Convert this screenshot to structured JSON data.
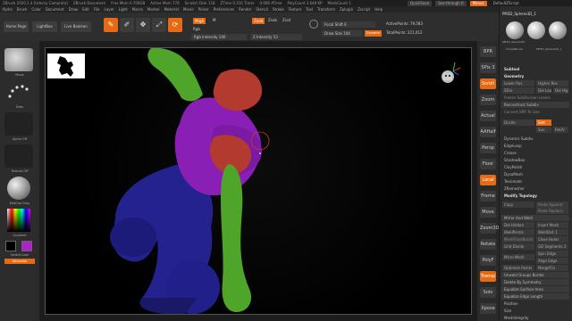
{
  "titlebar": {
    "title": "ZBrush 2020.1.4 [Udemy Camaroto]",
    "doc": "ZBrush Document",
    "stats": [
      "Free Mem 0.700GB",
      "Active Mem 776",
      "Scratch Disk 118",
      "ZTime 0.316 Timer",
      "0.006 ATime",
      "PolyCount 3.649 KP",
      "MeshCount 1"
    ]
  },
  "quicksave": {
    "quicksave_label": "QuickSave",
    "seethrough_label": "See-through 0",
    "menus_label": "Menus",
    "script_label": "DefaultZScript"
  },
  "menu": [
    "Alpha",
    "Brush",
    "Color",
    "Document",
    "Draw",
    "Edit",
    "File",
    "Layer",
    "Light",
    "Macro",
    "Marker",
    "Material",
    "Movie",
    "Picker",
    "Preferences",
    "Render",
    "Stencil",
    "Stroke",
    "Texture",
    "Tool",
    "Transform",
    "Zplugin",
    "Zscript",
    "Help"
  ],
  "toolbar": {
    "homepage": "Home Page",
    "lightbox": "LightBox",
    "liveboolean": "Live Boolean",
    "tools": [
      {
        "label": "Edit",
        "icon": "edit-icon"
      },
      {
        "label": "Draw",
        "icon": "draw-icon"
      },
      {
        "label": "Move",
        "icon": "move-icon"
      },
      {
        "label": "Scale",
        "icon": "scale-icon"
      },
      {
        "label": "Rotate",
        "icon": "rotate-icon"
      }
    ],
    "mrgb": "Mrgb",
    "rgb": "Rgb",
    "m": "M",
    "zadd": "Zadd",
    "zsub": "Zsub",
    "zcut": "Zcut",
    "rgb_intensity": "Rgb Intensity 100",
    "z_intensity": "Z Intensity 53",
    "focal_shift": "Focal Shift 0",
    "draw_size": "Draw Size 104",
    "dynamic": "Dynamic",
    "active_points": "ActivePoints: 79,583",
    "total_points": "TotalPoints: 221,012"
  },
  "leftshelf": {
    "brush": "Move",
    "stroke": "Dots",
    "alpha": "Alpha Off",
    "texture": "Texture Off",
    "material": "MatCap Gray",
    "gradient": "Gradient",
    "switch_color": "SwitchColor",
    "alternate": "Alternate"
  },
  "rightshelf": [
    "BPR",
    "SPix 3",
    "Scroll",
    "Zoom",
    "Actual",
    "AAHalf",
    "Persp",
    "Floor",
    "Local",
    "Frame",
    "Move",
    "Zoom3D",
    "Rotate",
    "PolyF",
    "Transp",
    "Solo",
    "Xpose"
  ],
  "tray": {
    "tool_name": "PM3D_Sphere3D_1",
    "thumbs": [
      "PM3D_Sphere3D",
      "SimpleBrush",
      "PM3D_Sphere3D_1"
    ],
    "subtool": "Subtool",
    "geometry": "Geometry",
    "lower_res": "Lower Res",
    "higher_res": "Higher Res",
    "sdiv": "SDiv",
    "del_lower": "Del Lower",
    "del_higher": "Del Higher",
    "freeze": "Freeze SubDivision Levels",
    "reconstruct": "Reconstruct Subdiv",
    "convert_bpr": "Convert BPR To Geo",
    "divide": "Divide",
    "smt": "Smt",
    "suv": "Suv",
    "rsdiv": "ReUV",
    "dynamic_subdiv": "Dynamic Subdiv",
    "edgeloop": "EdgeLoop",
    "crease": "Crease",
    "shadowbox": "ShadowBox",
    "clay_polish": "ClayPolish",
    "dynamesh": "DynaMesh",
    "tessimate": "Tessimate",
    "zremesher": "ZRemesher",
    "modify_topology": "Modify Topology",
    "copy": "Copy",
    "paste_append": "Paste Append",
    "paste_replace": "Paste Replace",
    "mirror_weld": "Mirror And Weld",
    "del_hidden": "Del Hidden",
    "insert_mesh": "Insert Mesh",
    "weld_points": "WeldPoints",
    "weld_dist": "WeldDist 1",
    "meshfrombrush": "MeshFromBrush",
    "close_holes": "Close Holes",
    "grid_divide": "Grid Divide",
    "gd_segments": "GD Segments 3",
    "spin_edge": "Spin Edge",
    "micro_mesh": "Micro Mesh",
    "align_edge": "Align Edge",
    "optimize_points": "Optimize Points",
    "merge_tris": "MergeTris",
    "unweld_groups": "Unweld Groups Border",
    "delete_symmetry": "Delete By Symmetry",
    "equalize_surface": "Equalize Surface Area",
    "equalize_edge": "Equalize Edge Length",
    "position": "Position",
    "size": "Size",
    "mesh_integrity": "MeshIntegrity"
  },
  "colors": {
    "accent": "#e66a14",
    "green": "#4fa52a",
    "purple": "#8a1fb5",
    "blue": "#23228f",
    "red": "#b23a2e"
  }
}
